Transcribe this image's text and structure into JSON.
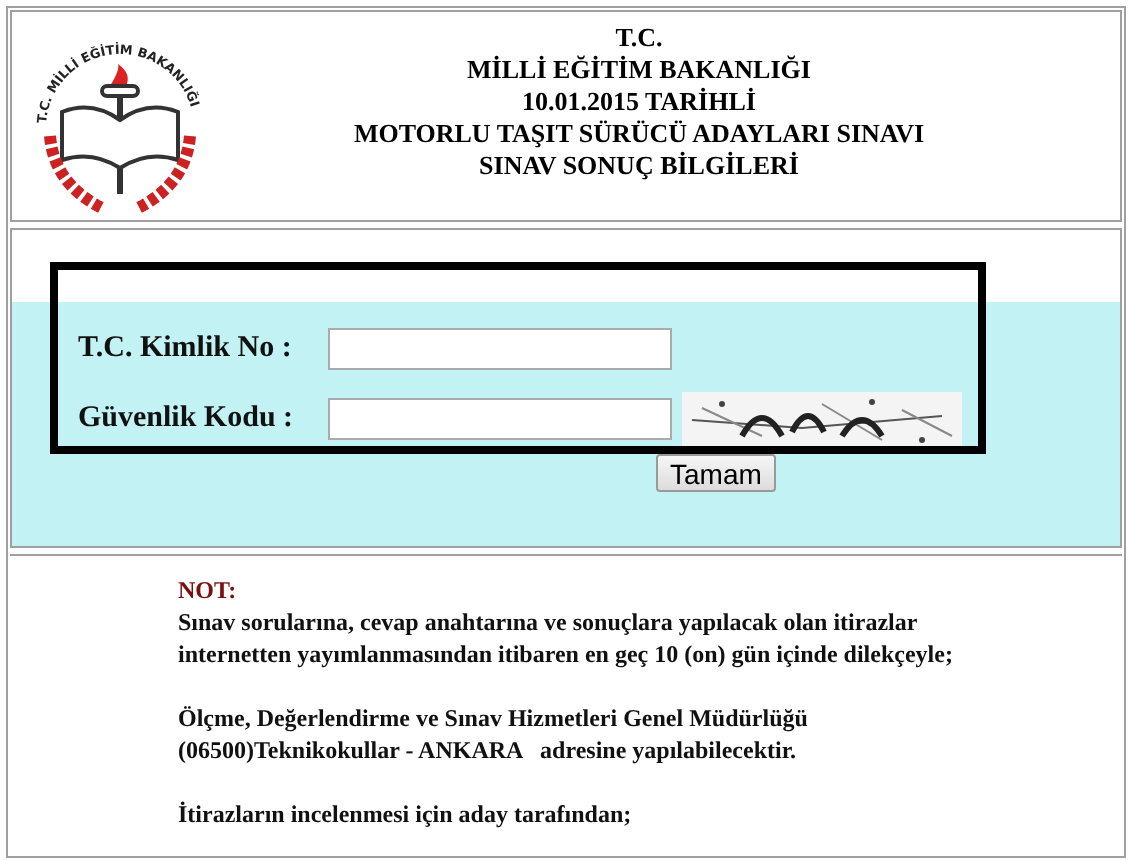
{
  "header": {
    "logo_text": "T.C. MİLLİ EĞİTİM BAKANLIĞI",
    "lines": [
      "T.C.",
      "MİLLİ EĞİTİM BAKANLIĞI",
      "10.01.2015 TARİHLİ",
      "MOTORLU TAŞIT SÜRÜCÜ ADAYLARI SINAVI",
      "SINAV SONUÇ BİLGİLERİ"
    ]
  },
  "form": {
    "fields": [
      {
        "label": "T.C. Kimlik No :",
        "kind": "text"
      },
      {
        "label": "Güvenlik Kodu :",
        "kind": "captcha"
      }
    ],
    "button": "Tamam",
    "highlighted": true
  },
  "note": {
    "title": "NOT:",
    "paragraphs": [
      "Sınav sorularına, cevap anahtarına ve sonuçlara yapılacak olan itirazlar internetten yayımlanmasından itibaren en geç 10 (on) gün içinde dilekçeyle;",
      "Ölçme, Değerlendirme ve Sınav Hizmetleri Genel Müdürlüğü (06500)Teknikokullar - ANKARA   adresine yapılabilecektir.",
      "İtirazların incelenmesi için aday tarafından;"
    ]
  }
}
